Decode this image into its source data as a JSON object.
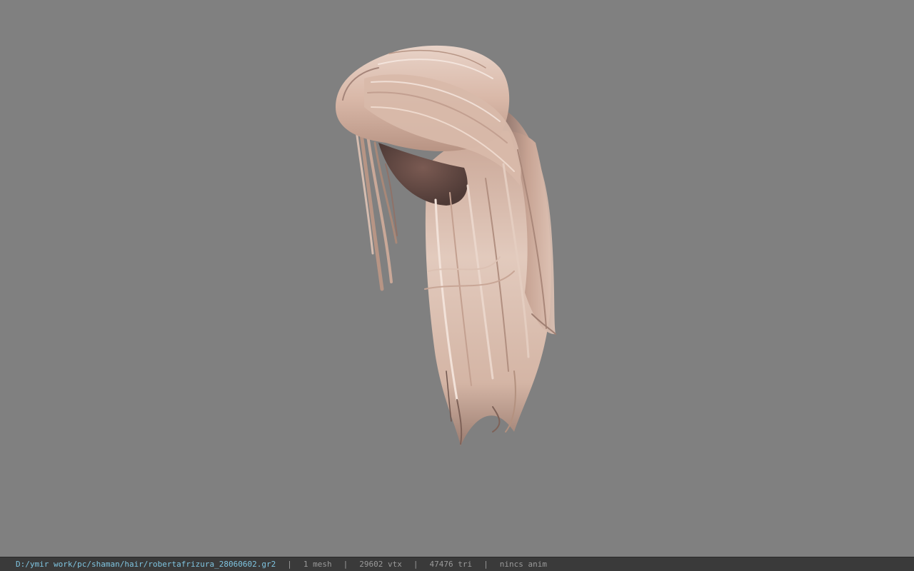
{
  "viewport": {
    "background_color": "#808080",
    "model_icon": "hair-mesh-model"
  },
  "statusbar": {
    "file_path": "D:/ymir work/pc/shaman/hair/robertafrizura_28060602.gr2",
    "separator": "|",
    "mesh_count": "1 mesh",
    "vertex_count": "29602 vtx",
    "triangle_count": "47476 tri",
    "anim_status": "nincs anim",
    "path_color": "#7fc4e0",
    "text_color": "#9a9a9a"
  }
}
